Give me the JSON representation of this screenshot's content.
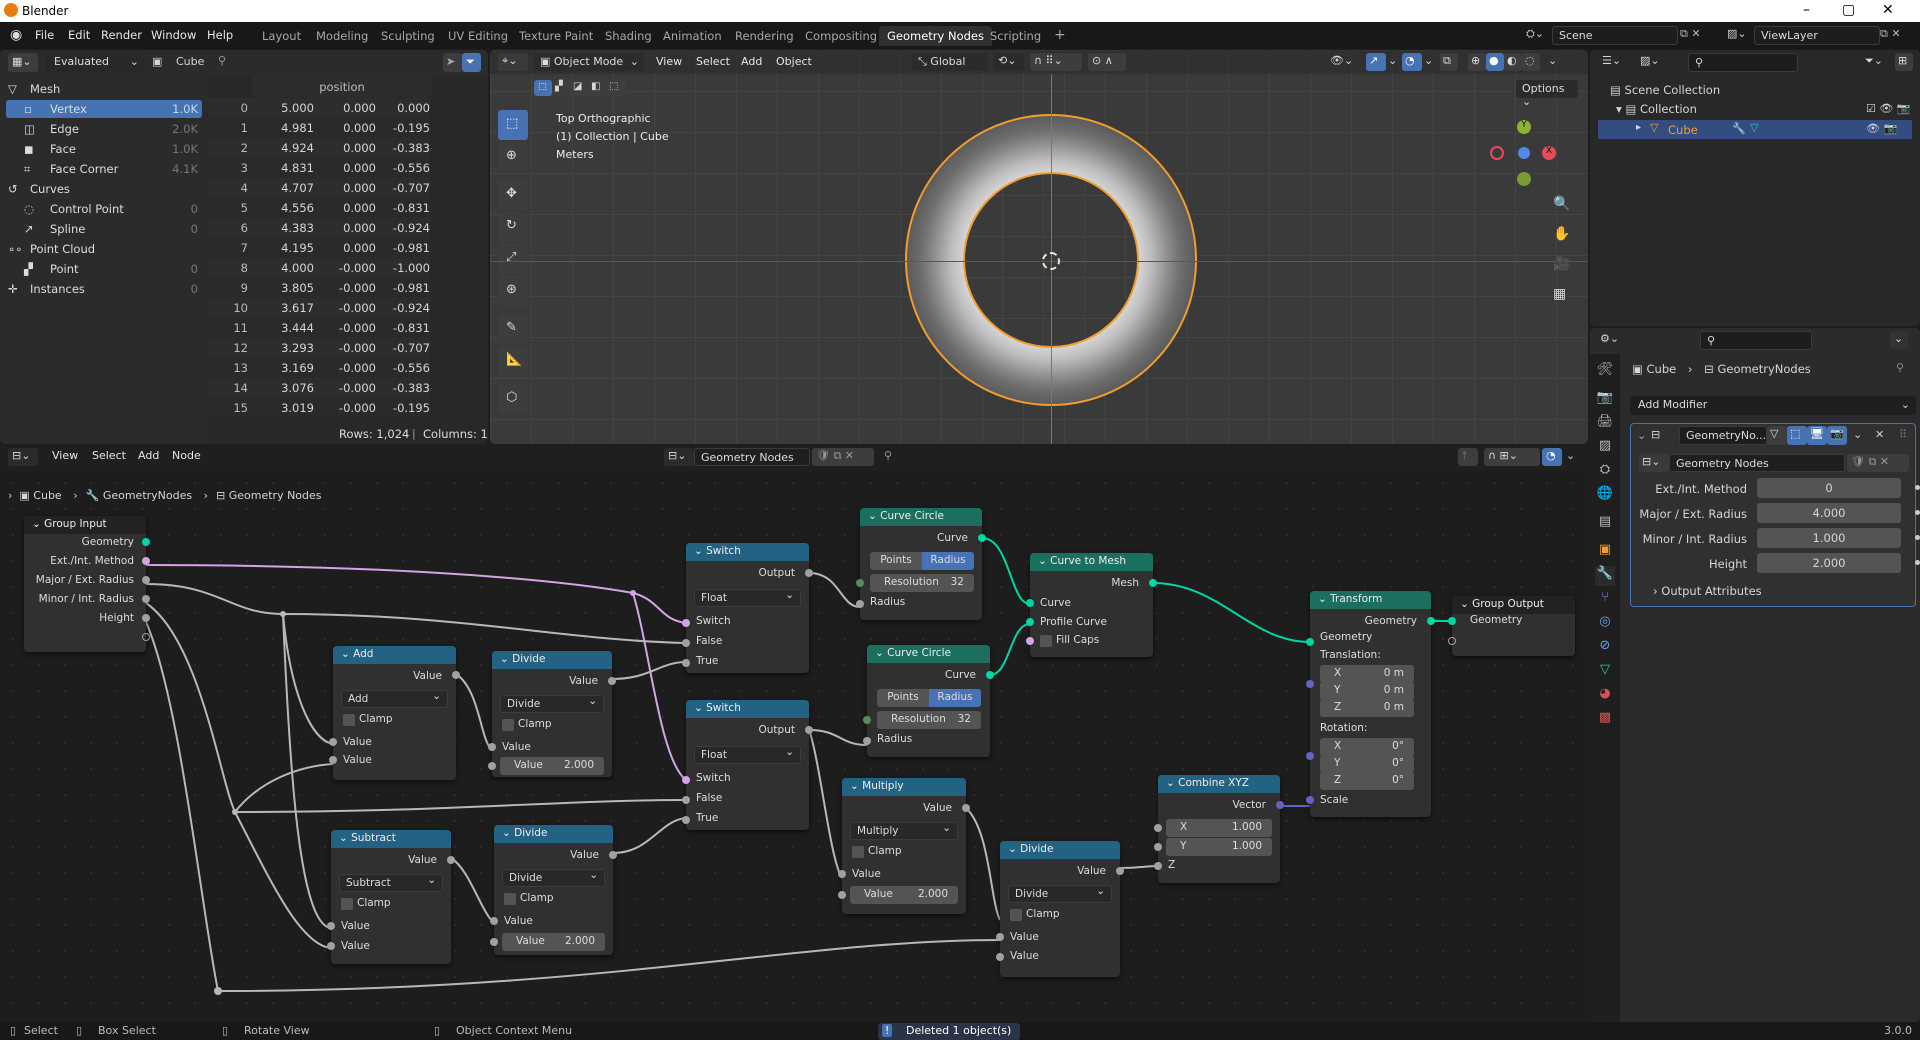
{
  "window": {
    "title": "Blender",
    "controls": {
      "minimize": "–",
      "maximize": "▢",
      "close": "✕"
    }
  },
  "menu": [
    "File",
    "Edit",
    "Render",
    "Window",
    "Help"
  ],
  "workspaces": [
    "Layout",
    "Modeling",
    "Sculpting",
    "UV Editing",
    "Texture Paint",
    "Shading",
    "Animation",
    "Rendering",
    "Compositing",
    "Geometry Nodes",
    "Scripting"
  ],
  "active_workspace": "Geometry Nodes",
  "add_workspace": "+",
  "scene": {
    "label": "Scene",
    "view_layer": "ViewLayer"
  },
  "spreadsheet": {
    "evaluated": "Evaluated",
    "object": "Cube",
    "column_header": "position",
    "domains": [
      {
        "label": "Mesh",
        "count": "",
        "level": 0,
        "icon": "mesh-icon"
      },
      {
        "label": "Vertex",
        "count": "1.0K",
        "level": 1,
        "active": true,
        "icon": "vertex-icon"
      },
      {
        "label": "Edge",
        "count": "2.0K",
        "level": 1,
        "icon": "edge-icon"
      },
      {
        "label": "Face",
        "count": "1.0K",
        "level": 1,
        "icon": "face-icon"
      },
      {
        "label": "Face Corner",
        "count": "4.1K",
        "level": 1,
        "icon": "face-corner-icon"
      },
      {
        "label": "Curves",
        "count": "",
        "level": 0,
        "icon": "curves-icon"
      },
      {
        "label": "Control Point",
        "count": "0",
        "level": 1,
        "icon": "control-point-icon"
      },
      {
        "label": "Spline",
        "count": "0",
        "level": 1,
        "icon": "spline-icon"
      },
      {
        "label": "Point Cloud",
        "count": "",
        "level": 0,
        "icon": "point-cloud-icon"
      },
      {
        "label": "Point",
        "count": "0",
        "level": 1,
        "icon": "point-icon"
      },
      {
        "label": "Instances",
        "count": "0",
        "level": 0,
        "icon": "instances-icon"
      }
    ],
    "rows": [
      [
        "0",
        "5.000",
        "0.000",
        "0.000"
      ],
      [
        "1",
        "4.981",
        "0.000",
        "-0.195"
      ],
      [
        "2",
        "4.924",
        "0.000",
        "-0.383"
      ],
      [
        "3",
        "4.831",
        "0.000",
        "-0.556"
      ],
      [
        "4",
        "4.707",
        "0.000",
        "-0.707"
      ],
      [
        "5",
        "4.556",
        "0.000",
        "-0.831"
      ],
      [
        "6",
        "4.383",
        "0.000",
        "-0.924"
      ],
      [
        "7",
        "4.195",
        "0.000",
        "-0.981"
      ],
      [
        "8",
        "4.000",
        "-0.000",
        "-1.000"
      ],
      [
        "9",
        "3.805",
        "-0.000",
        "-0.981"
      ],
      [
        "10",
        "3.617",
        "-0.000",
        "-0.924"
      ],
      [
        "11",
        "3.444",
        "-0.000",
        "-0.831"
      ],
      [
        "12",
        "3.293",
        "-0.000",
        "-0.707"
      ],
      [
        "13",
        "3.169",
        "-0.000",
        "-0.556"
      ],
      [
        "14",
        "3.076",
        "-0.000",
        "-0.383"
      ],
      [
        "15",
        "3.019",
        "-0.000",
        "-0.195"
      ]
    ],
    "footer": {
      "rows": "Rows: 1,024",
      "sep": "|",
      "columns": "Columns: 1"
    }
  },
  "viewport": {
    "mode": "Object Mode",
    "menus": [
      "View",
      "Select",
      "Add",
      "Object"
    ],
    "orientation": "Global",
    "options": "Options",
    "info": [
      "Top Orthographic",
      "(1) Collection | Cube",
      "Meters"
    ],
    "gizmo": {
      "y": "Y",
      "x": "X"
    }
  },
  "outliner": {
    "items": [
      {
        "label": "Scene Collection",
        "level": 0
      },
      {
        "label": "Collection",
        "level": 1
      },
      {
        "label": "Cube",
        "level": 2,
        "selected": true
      }
    ]
  },
  "properties": {
    "breadcrumb": [
      "Cube",
      "GeometryNodes"
    ],
    "add_modifier": "Add Modifier",
    "modifier_name": "GeometryNo...",
    "node_group": "Geometry Nodes",
    "inputs": [
      {
        "label": "Ext./Int. Method",
        "value": "0"
      },
      {
        "label": "Major / Ext. Radius",
        "value": "4.000"
      },
      {
        "label": "Minor / Int. Radius",
        "value": "1.000"
      },
      {
        "label": "Height",
        "value": "2.000"
      }
    ],
    "output_attributes": "Output Attributes"
  },
  "node_editor": {
    "menus": [
      "View",
      "Select",
      "Add",
      "Node"
    ],
    "node_tree": "Geometry Nodes",
    "breadcrumb": [
      "Cube",
      "GeometryNodes",
      "Geometry Nodes"
    ],
    "nodes": {
      "group_input": {
        "title": "Group Input",
        "outputs": [
          "Geometry",
          "Ext./Int. Method",
          "Major / Ext. Radius",
          "Minor / Int. Radius",
          "Height"
        ]
      },
      "add": {
        "title": "Add",
        "out": "Value",
        "op": "Add",
        "clamp": "Clamp",
        "in": [
          "Value",
          "Value"
        ]
      },
      "divide1": {
        "title": "Divide",
        "out": "Value",
        "op": "Divide",
        "clamp": "Clamp",
        "in": "Value",
        "field_label": "Value",
        "field_value": "2.000"
      },
      "subtract": {
        "title": "Subtract",
        "out": "Value",
        "op": "Subtract",
        "clamp": "Clamp",
        "in": [
          "Value",
          "Value"
        ]
      },
      "divide2": {
        "title": "Divide",
        "out": "Value",
        "op": "Divide",
        "clamp": "Clamp",
        "in": "Value",
        "field_label": "Value",
        "field_value": "2.000"
      },
      "switch1": {
        "title": "Switch",
        "out": "Output",
        "type": "Float",
        "in": [
          "Switch",
          "False",
          "True"
        ]
      },
      "switch2": {
        "title": "Switch",
        "out": "Output",
        "type": "Float",
        "in": [
          "Switch",
          "False",
          "True"
        ]
      },
      "circle1": {
        "title": "Curve Circle",
        "out": "Curve",
        "modes": [
          "Points",
          "Radius"
        ],
        "res_label": "Resolution",
        "res_value": "32",
        "in": "Radius"
      },
      "circle2": {
        "title": "Curve Circle",
        "out": "Curve",
        "modes": [
          "Points",
          "Radius"
        ],
        "res_label": "Resolution",
        "res_value": "32",
        "in": "Radius"
      },
      "curve_to_mesh": {
        "title": "Curve to Mesh",
        "out": "Mesh",
        "in": [
          "Curve",
          "Profile Curve",
          "Fill Caps"
        ]
      },
      "multiply": {
        "title": "Multiply",
        "out": "Value",
        "op": "Multiply",
        "clamp": "Clamp",
        "in": "Value",
        "field_label": "Value",
        "field_value": "2.000"
      },
      "divide3": {
        "title": "Divide",
        "out": "Value",
        "op": "Divide",
        "clamp": "Clamp",
        "in": [
          "Value",
          "Value"
        ]
      },
      "combine": {
        "title": "Combine XYZ",
        "out": "Vector",
        "fields": [
          [
            "X",
            "1.000"
          ],
          [
            "Y",
            "1.000"
          ]
        ],
        "in": "Z"
      },
      "transform": {
        "title": "Transform",
        "out": "Geometry",
        "in": "Geometry",
        "translation": "Translation:",
        "t": [
          [
            "X",
            "0 m"
          ],
          [
            "Y",
            "0 m"
          ],
          [
            "Z",
            "0 m"
          ]
        ],
        "rotation": "Rotation:",
        "r": [
          [
            "X",
            "0°"
          ],
          [
            "Y",
            "0°"
          ],
          [
            "Z",
            "0°"
          ]
        ],
        "scale": "Scale"
      },
      "group_output": {
        "title": "Group Output",
        "in": "Geometry"
      }
    }
  },
  "status": {
    "select": "Select",
    "box_select": "Box Select",
    "rotate": "Rotate View",
    "context": "Object Context Menu",
    "message": "Deleted 1 object(s)",
    "version": "3.0.0"
  },
  "colors": {
    "accent": "#4772b3",
    "selected_orange": "#f39c2f",
    "geometry_socket": "#00d6a3",
    "int_socket": "#d5a3e6",
    "vector_socket": "#6363c7"
  }
}
